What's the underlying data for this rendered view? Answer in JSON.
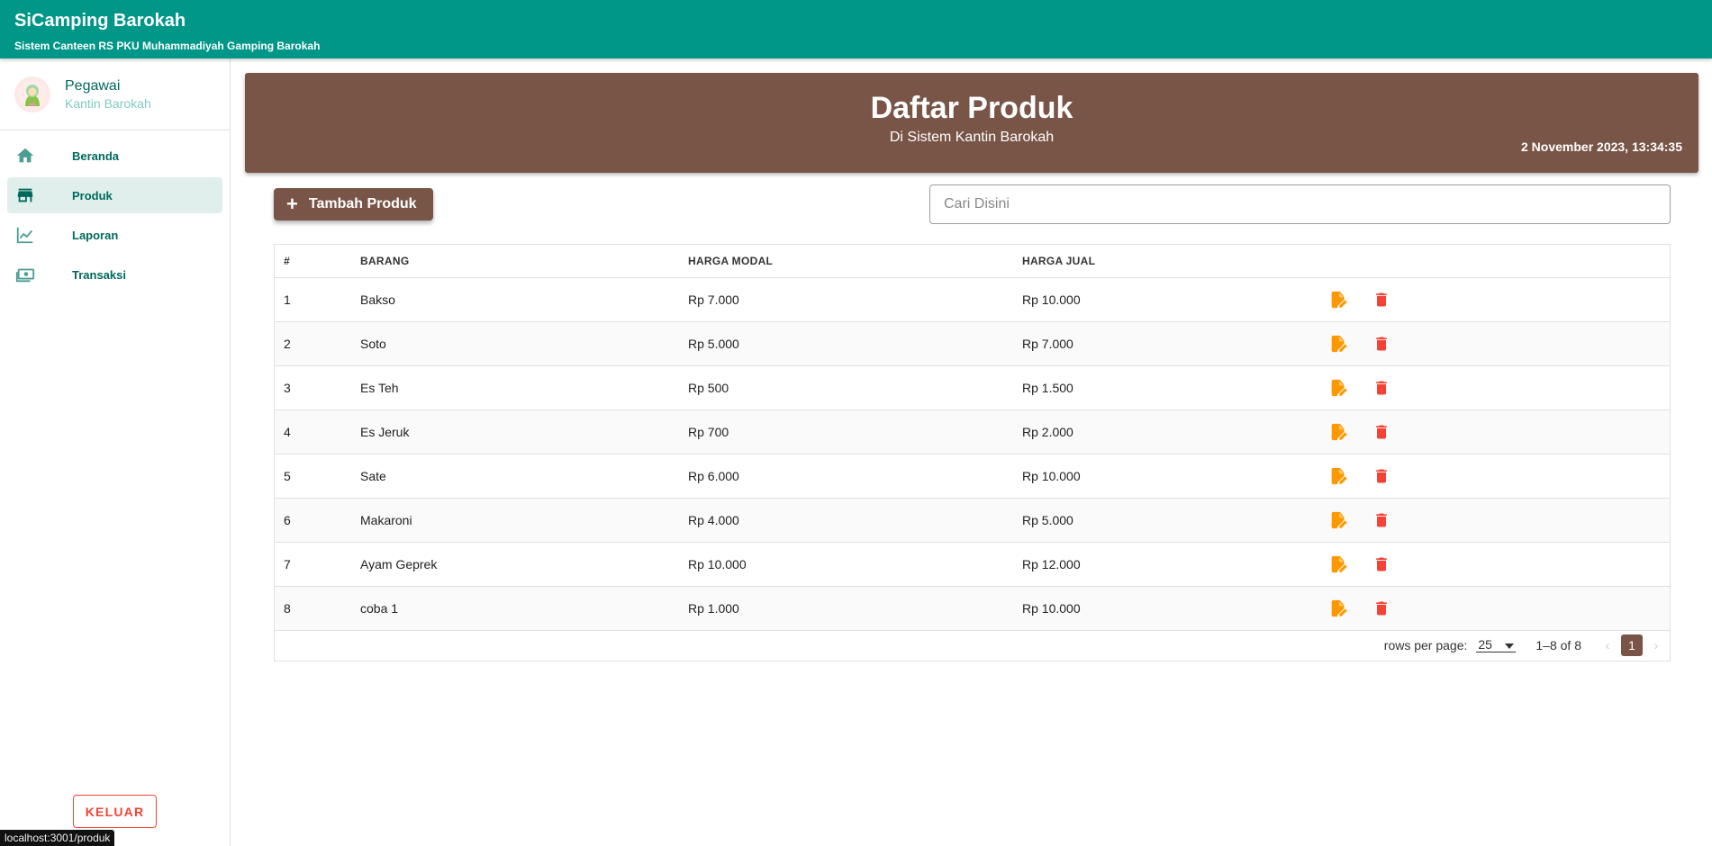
{
  "app": {
    "title": "SiCamping Barokah",
    "subtitle": "Sistem Canteen RS PKU Muhammadiyah Gamping Barokah"
  },
  "profile": {
    "name": "Pegawai",
    "sub": "Kantin Barokah"
  },
  "nav": {
    "items": [
      {
        "label": "Beranda",
        "icon": "home-icon"
      },
      {
        "label": "Produk",
        "icon": "store-icon",
        "active": true
      },
      {
        "label": "Laporan",
        "icon": "chart-line-icon"
      },
      {
        "label": "Transaksi",
        "icon": "cash-icon"
      }
    ]
  },
  "logout_label": "KELUAR",
  "status_url": "localhost:3001/produk",
  "banner": {
    "title": "Daftar Produk",
    "subtitle": "Di Sistem Kantin Barokah",
    "datetime": "2 November 2023, 13:34:35"
  },
  "add_label": "Tambah Produk",
  "search_placeholder": "Cari Disini",
  "table": {
    "headers": [
      "#",
      "BARANG",
      "HARGA MODAL",
      "HARGA JUAL",
      ""
    ],
    "rows": [
      {
        "no": "1",
        "barang": "Bakso",
        "modal": "Rp 7.000",
        "jual": "Rp 10.000"
      },
      {
        "no": "2",
        "barang": "Soto",
        "modal": "Rp 5.000",
        "jual": "Rp 7.000"
      },
      {
        "no": "3",
        "barang": "Es Teh",
        "modal": "Rp 500",
        "jual": "Rp 1.500"
      },
      {
        "no": "4",
        "barang": "Es Jeruk",
        "modal": "Rp 700",
        "jual": "Rp 2.000"
      },
      {
        "no": "5",
        "barang": "Sate",
        "modal": "Rp 6.000",
        "jual": "Rp 10.000"
      },
      {
        "no": "6",
        "barang": "Makaroni",
        "modal": "Rp 4.000",
        "jual": "Rp 5.000"
      },
      {
        "no": "7",
        "barang": "Ayam Geprek",
        "modal": "Rp 10.000",
        "jual": "Rp 12.000"
      },
      {
        "no": "8",
        "barang": "coba 1",
        "modal": "Rp 1.000",
        "jual": "Rp 10.000"
      }
    ]
  },
  "pagination": {
    "rows_per_page_label": "rows per page:",
    "rows_per_page": "25",
    "range": "1–8 of 8",
    "current_page": "1"
  },
  "colors": {
    "primary": "#009688",
    "brown": "#795548",
    "edit": "#ff9800",
    "delete": "#f44336"
  }
}
